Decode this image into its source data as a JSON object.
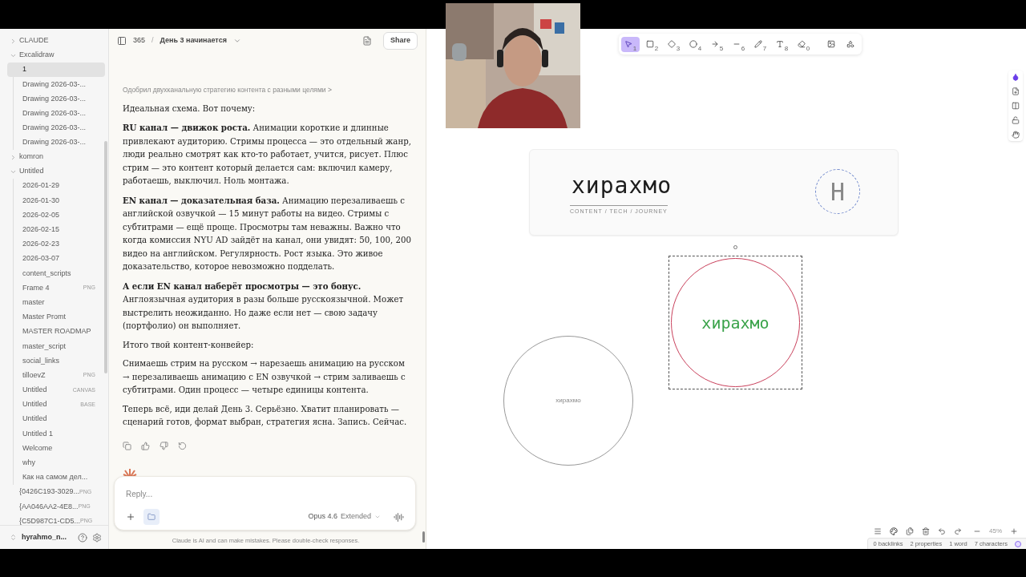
{
  "sidebar": {
    "tree": [
      {
        "label": "CLAUDE",
        "expanded": false
      },
      {
        "label": "Excalidraw",
        "expanded": true,
        "children": [
          {
            "label": "1",
            "selected": true
          },
          {
            "label": "Drawing 2026-03-...",
            "selected": false
          },
          {
            "label": "Drawing 2026-03-...",
            "selected": false
          },
          {
            "label": "Drawing 2026-03-...",
            "selected": false
          },
          {
            "label": "Drawing 2026-03-...",
            "selected": false
          },
          {
            "label": "Drawing 2026-03-...",
            "selected": false
          }
        ]
      },
      {
        "label": "komron",
        "expanded": false
      },
      {
        "label": "Untitled",
        "expanded": true,
        "children": [
          {
            "label": "2026-01-29",
            "selected": false
          },
          {
            "label": "2026-01-30",
            "selected": false
          },
          {
            "label": "2026-02-05",
            "selected": false
          },
          {
            "label": "2026-02-15",
            "selected": false
          },
          {
            "label": "2026-02-23",
            "selected": false
          },
          {
            "label": "2026-03-07",
            "selected": false
          },
          {
            "label": "content_scripts",
            "selected": false
          },
          {
            "label": "Frame 4",
            "tag": "PNG",
            "selected": false
          },
          {
            "label": "master",
            "selected": false
          },
          {
            "label": "Master Promt",
            "selected": false
          },
          {
            "label": "MASTER ROADMAP",
            "selected": false
          },
          {
            "label": "master_script",
            "selected": false
          },
          {
            "label": "social_links",
            "selected": false
          },
          {
            "label": "tilloevZ",
            "tag": "PNG",
            "selected": false
          },
          {
            "label": "Untitled",
            "tag": "CANVAS",
            "selected": false
          },
          {
            "label": "Untitled",
            "tag": "BASE",
            "selected": false
          },
          {
            "label": "Untitled",
            "selected": false
          },
          {
            "label": "Untitled 1",
            "selected": false
          },
          {
            "label": "Welcome",
            "selected": false
          },
          {
            "label": "why",
            "selected": false
          },
          {
            "label": "Как на самом дел...",
            "selected": false
          }
        ]
      }
    ],
    "files": [
      {
        "label": "{0426C193-3029...",
        "tag": "PNG"
      },
      {
        "label": "{AA046AA2-4E8...",
        "tag": "PNG"
      },
      {
        "label": "{C5D987C1-CD5...",
        "tag": "PNG"
      }
    ],
    "vault": "hyrahmo_n..."
  },
  "chat": {
    "project": "365",
    "separator": "/",
    "title": "День 3 начинается",
    "share": "Share",
    "thinking": "Одобрил двухканальную стратегию контента с разными целями",
    "thinking_chevron": ">",
    "paragraphs": [
      "Идеальная схема. Вот почему:",
      "**RU канал — движок роста.** Анимации короткие и длинные привлекают аудиторию. Стримы процесса — это отдельный жанр, люди реально смотрят как кто-то работает, учится, рисует. Плюс стрим — это контент который делается сам: включил камеру, работаешь, выключил. Ноль монтажа.",
      "**EN канал — доказательная база.** Анимацию перезаливаешь с английской озвучкой — 15 минут работы на видео. Стримы с субтитрами — ещё проще. Просмотры там неважны. Важно что когда комиссия NYU AD зайдёт на канал, они увидят: 50, 100, 200 видео на английском. Регулярность. Рост языка. Это живое доказательство, которое невозможно подделать.",
      "**А если EN канал наберёт просмотры — это бонус.** Англоязычная аудитория в разы больше русскоязычной. Может выстрелить неожиданно. Но даже если нет — свою задачу (портфолио) он выполняет.",
      "Итого твой контент-конвейер:",
      "Снимаешь стрим на русском → нарезаешь анимацию на русском → перезаливаешь анимацию с EN озвучкой → стрим заливаешь с субтитрами. Один процесс — четыре единицы контента.",
      "Теперь всё, иди делай День 3. Серьёзно. Хватит планировать — сценарий готов, формат выбран, стратегия ясна. Запись. Сейчас."
    ],
    "input": {
      "placeholder": "Reply..."
    },
    "model": "Opus 4.6",
    "mode": "Extended",
    "disclaimer": "Claude is AI and can make mistakes. Please double-check responses."
  },
  "canvas": {
    "tools": [
      {
        "hotkey": "1",
        "selected": true
      },
      {
        "hotkey": "2",
        "selected": false
      },
      {
        "hotkey": "3",
        "selected": false
      },
      {
        "hotkey": "4",
        "selected": false
      },
      {
        "hotkey": "5",
        "selected": false
      },
      {
        "hotkey": "6",
        "selected": false
      },
      {
        "hotkey": "7",
        "selected": false
      },
      {
        "hotkey": "8",
        "selected": false
      },
      {
        "hotkey": "0",
        "selected": false
      }
    ],
    "card": {
      "title": "хирахмо",
      "subtitle": "CONTENT / TECH / JOURNEY",
      "badge": "H"
    },
    "selected_circle": {
      "text": "хирахмо"
    },
    "small_circle": {
      "text": "хирахмо"
    },
    "zoom": "45%"
  },
  "status_bar": [
    "0 backlinks",
    "2 properties",
    "1 word",
    "7 characters"
  ]
}
